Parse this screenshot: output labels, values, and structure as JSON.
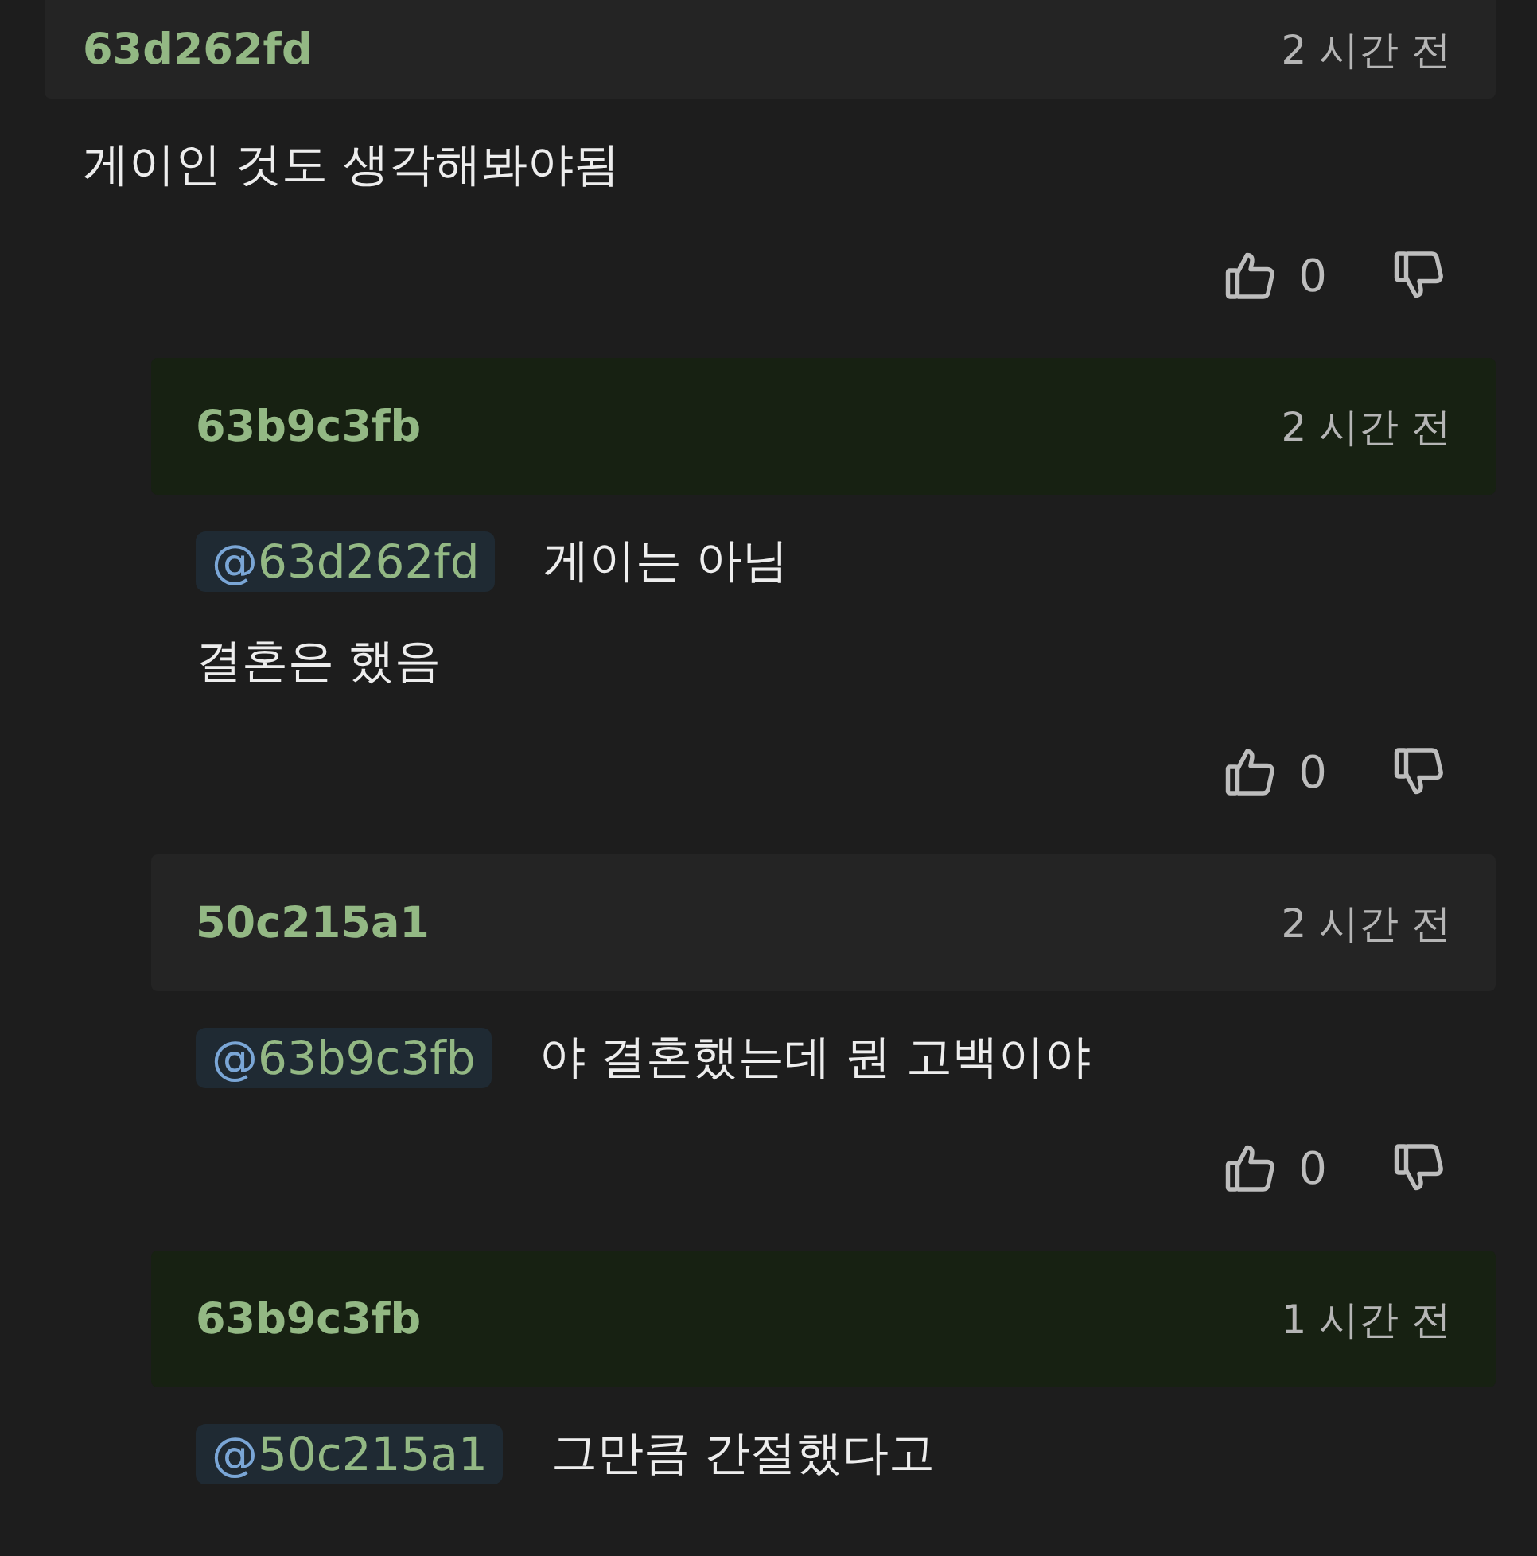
{
  "comments": [
    {
      "user": "63d262fd",
      "time": "2 시간 전",
      "highlighted": false,
      "lines": [
        "게이인 것도 생각해봐야됨"
      ],
      "likes": "0",
      "children": [
        {
          "user": "63b9c3fb",
          "time": "2 시간 전",
          "highlighted": true,
          "mention": {
            "at": "@",
            "id": "63d262fd"
          },
          "lines": [
            "게이는 아님",
            "결혼은 했음"
          ],
          "likes": "0"
        },
        {
          "user": "50c215a1",
          "time": "2 시간 전",
          "highlighted": false,
          "mention": {
            "at": "@",
            "id": "63b9c3fb"
          },
          "lines": [
            "야 결혼했는데 뭔 고백이야"
          ],
          "likes": "0"
        },
        {
          "user": "63b9c3fb",
          "time": "1 시간 전",
          "highlighted": true,
          "mention": {
            "at": "@",
            "id": "50c215a1"
          },
          "lines": [
            "그만큼 간절했다고"
          ]
        }
      ]
    }
  ]
}
